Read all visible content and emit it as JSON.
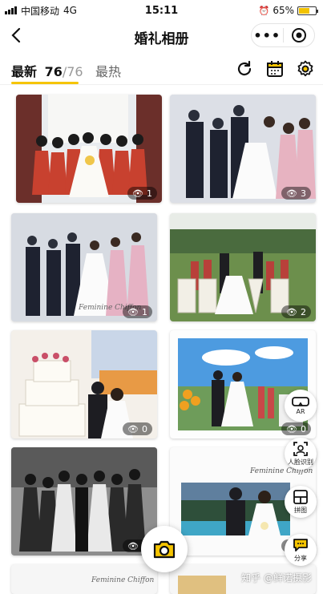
{
  "status_bar": {
    "carrier": "中国移动",
    "network": "4G",
    "time": "15:11",
    "battery": "65%",
    "battery_level": 0.65
  },
  "nav": {
    "title": "婚礼相册",
    "more_label": "•••"
  },
  "tabs": {
    "latest_label": "最新",
    "latest_count": "76",
    "latest_total": "/76",
    "hot_label": "最热"
  },
  "photos": [
    {
      "views": "1",
      "scene": "bride-bridesmaids-red"
    },
    {
      "views": "3",
      "scene": "groomsmen-bridesmaids-pink"
    },
    {
      "views": "1",
      "scene": "group-jumping-studio"
    },
    {
      "views": "2",
      "scene": "love-letters-lawn"
    },
    {
      "views": "0",
      "scene": "cake-couple"
    },
    {
      "views": "0",
      "scene": "couple-outdoor-flowers"
    },
    {
      "views": "1",
      "scene": "bw-group"
    },
    {
      "views": "0",
      "scene": "couple-poolside"
    }
  ],
  "side_buttons": {
    "ar_label": "AR",
    "face_label": "人脸识别",
    "collage_label": "拼图",
    "share_label": "分享"
  },
  "watermark": "知乎 @鲜诺摄影",
  "colors": {
    "accent": "#f5c400",
    "badge_bg": "rgba(0,0,0,0.45)"
  }
}
